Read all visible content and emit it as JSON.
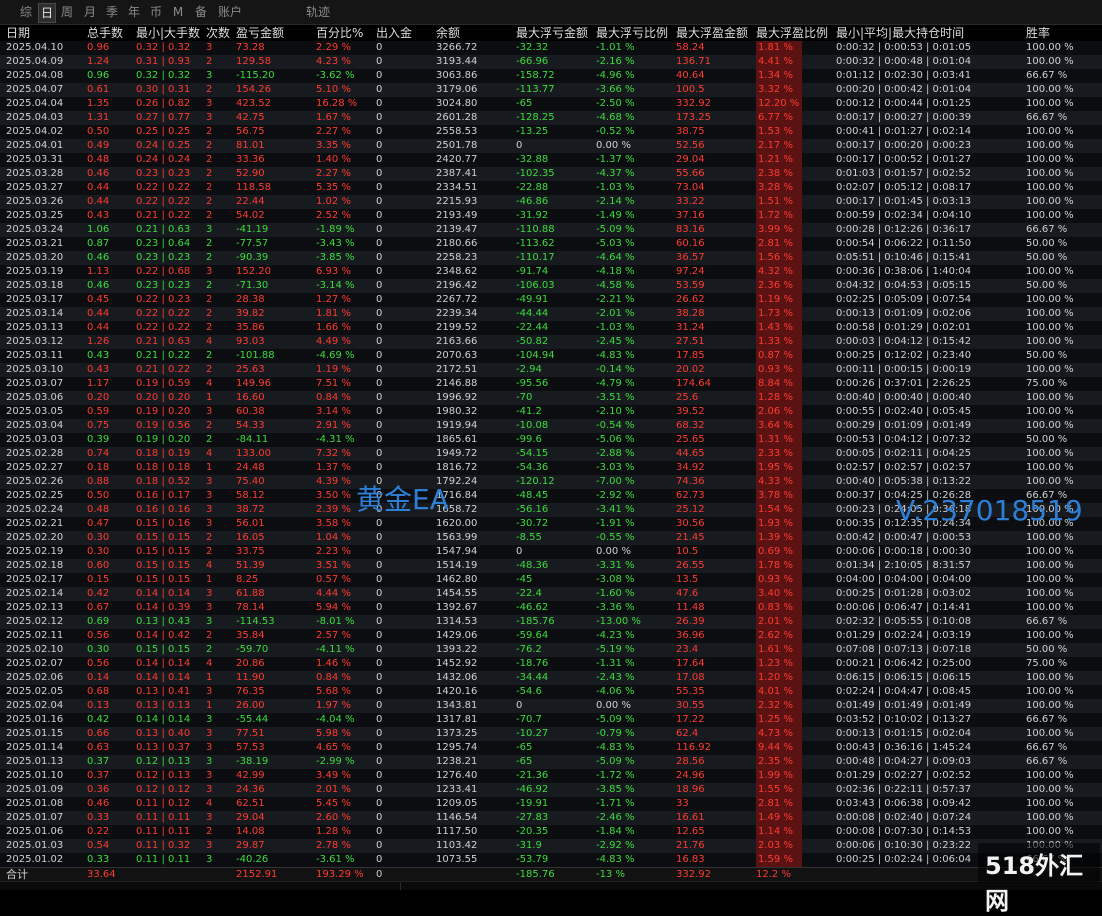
{
  "tabs": [
    {
      "label": "综",
      "active": false
    },
    {
      "label": "日",
      "active": true
    },
    {
      "label": "周",
      "active": false
    },
    {
      "label": "月",
      "active": false
    },
    {
      "label": "季",
      "active": false
    },
    {
      "label": "年",
      "active": false
    },
    {
      "label": "币",
      "active": false
    },
    {
      "label": "M",
      "active": false
    },
    {
      "label": "备",
      "active": false
    },
    {
      "label": "账户",
      "active": false
    },
    {
      "label": "轨迹",
      "active": false
    }
  ],
  "columns": [
    "日期",
    "总手数",
    "最小|大手数",
    "次数",
    "盈亏金额",
    "百分比%",
    "出入金",
    "余额",
    "最大浮亏金额",
    "最大浮亏比例",
    "最大浮盈金额",
    "最大浮盈比例",
    "最小|平均|最大持仓时间",
    "胜率"
  ],
  "rows": [
    [
      "2025.04.10",
      "0.96",
      "0.32 | 0.32",
      "3",
      "73.28",
      "2.29 %",
      "0",
      "3266.72",
      "-32.32",
      "-1.01 %",
      "58.24",
      "1.81 %",
      "0:00:32 | 0:00:53 | 0:01:05",
      "100.00 %"
    ],
    [
      "2025.04.09",
      "1.24",
      "0.31 | 0.93",
      "2",
      "129.58",
      "4.23 %",
      "0",
      "3193.44",
      "-66.96",
      "-2.16 %",
      "136.71",
      "4.41 %",
      "0:00:32 | 0:00:48 | 0:01:04",
      "100.00 %"
    ],
    [
      "2025.04.08",
      "0.96",
      "0.32 | 0.32",
      "3",
      "-115.20",
      "-3.62 %",
      "0",
      "3063.86",
      "-158.72",
      "-4.96 %",
      "40.64",
      "1.34 %",
      "0:01:12 | 0:02:30 | 0:03:41",
      "66.67 %"
    ],
    [
      "2025.04.07",
      "0.61",
      "0.30 | 0.31",
      "2",
      "154.26",
      "5.10 %",
      "0",
      "3179.06",
      "-113.77",
      "-3.66 %",
      "100.5",
      "3.32 %",
      "0:00:20 | 0:00:42 | 0:01:04",
      "100.00 %"
    ],
    [
      "2025.04.04",
      "1.35",
      "0.26 | 0.82",
      "3",
      "423.52",
      "16.28 %",
      "0",
      "3024.80",
      "-65",
      "-2.50 %",
      "332.92",
      "12.20 %",
      "0:00:12 | 0:00:44 | 0:01:25",
      "100.00 %"
    ],
    [
      "2025.04.03",
      "1.31",
      "0.27 | 0.77",
      "3",
      "42.75",
      "1.67 %",
      "0",
      "2601.28",
      "-128.25",
      "-4.68 %",
      "173.25",
      "6.77 %",
      "0:00:17 | 0:00:27 | 0:00:39",
      "66.67 %"
    ],
    [
      "2025.04.02",
      "0.50",
      "0.25 | 0.25",
      "2",
      "56.75",
      "2.27 %",
      "0",
      "2558.53",
      "-13.25",
      "-0.52 %",
      "38.75",
      "1.53 %",
      "0:00:41 | 0:01:27 | 0:02:14",
      "100.00 %"
    ],
    [
      "2025.04.01",
      "0.49",
      "0.24 | 0.25",
      "2",
      "81.01",
      "3.35 %",
      "0",
      "2501.78",
      "0",
      "0.00 %",
      "52.56",
      "2.17 %",
      "0:00:17 | 0:00:20 | 0:00:23",
      "100.00 %"
    ],
    [
      "2025.03.31",
      "0.48",
      "0.24 | 0.24",
      "2",
      "33.36",
      "1.40 %",
      "0",
      "2420.77",
      "-32.88",
      "-1.37 %",
      "29.04",
      "1.21 %",
      "0:00:17 | 0:00:52 | 0:01:27",
      "100.00 %"
    ],
    [
      "2025.03.28",
      "0.46",
      "0.23 | 0.23",
      "2",
      "52.90",
      "2.27 %",
      "0",
      "2387.41",
      "-102.35",
      "-4.37 %",
      "55.66",
      "2.38 %",
      "0:01:03 | 0:01:57 | 0:02:52",
      "100.00 %"
    ],
    [
      "2025.03.27",
      "0.44",
      "0.22 | 0.22",
      "2",
      "118.58",
      "5.35 %",
      "0",
      "2334.51",
      "-22.88",
      "-1.03 %",
      "73.04",
      "3.28 %",
      "0:02:07 | 0:05:12 | 0:08:17",
      "100.00 %"
    ],
    [
      "2025.03.26",
      "0.44",
      "0.22 | 0.22",
      "2",
      "22.44",
      "1.02 %",
      "0",
      "2215.93",
      "-46.86",
      "-2.14 %",
      "33.22",
      "1.51 %",
      "0:00:17 | 0:01:45 | 0:03:13",
      "100.00 %"
    ],
    [
      "2025.03.25",
      "0.43",
      "0.21 | 0.22",
      "2",
      "54.02",
      "2.52 %",
      "0",
      "2193.49",
      "-31.92",
      "-1.49 %",
      "37.16",
      "1.72 %",
      "0:00:59 | 0:02:34 | 0:04:10",
      "100.00 %"
    ],
    [
      "2025.03.24",
      "1.06",
      "0.21 | 0.63",
      "3",
      "-41.19",
      "-1.89 %",
      "0",
      "2139.47",
      "-110.88",
      "-5.09 %",
      "83.16",
      "3.99 %",
      "0:00:28 | 0:12:26 | 0:36:17",
      "66.67 %"
    ],
    [
      "2025.03.21",
      "0.87",
      "0.23 | 0.64",
      "2",
      "-77.57",
      "-3.43 %",
      "0",
      "2180.66",
      "-113.62",
      "-5.03 %",
      "60.16",
      "2.81 %",
      "0:00:54 | 0:06:22 | 0:11:50",
      "50.00 %"
    ],
    [
      "2025.03.20",
      "0.46",
      "0.23 | 0.23",
      "2",
      "-90.39",
      "-3.85 %",
      "0",
      "2258.23",
      "-110.17",
      "-4.64 %",
      "36.57",
      "1.56 %",
      "0:05:51 | 0:10:46 | 0:15:41",
      "50.00 %"
    ],
    [
      "2025.03.19",
      "1.13",
      "0.22 | 0.68",
      "3",
      "152.20",
      "6.93 %",
      "0",
      "2348.62",
      "-91.74",
      "-4.18 %",
      "97.24",
      "4.32 %",
      "0:00:36 | 0:38:06 | 1:40:04",
      "100.00 %"
    ],
    [
      "2025.03.18",
      "0.46",
      "0.23 | 0.23",
      "2",
      "-71.30",
      "-3.14 %",
      "0",
      "2196.42",
      "-106.03",
      "-4.58 %",
      "53.59",
      "2.36 %",
      "0:04:32 | 0:04:53 | 0:05:15",
      "50.00 %"
    ],
    [
      "2025.03.17",
      "0.45",
      "0.22 | 0.23",
      "2",
      "28.38",
      "1.27 %",
      "0",
      "2267.72",
      "-49.91",
      "-2.21 %",
      "26.62",
      "1.19 %",
      "0:02:25 | 0:05:09 | 0:07:54",
      "100.00 %"
    ],
    [
      "2025.03.14",
      "0.44",
      "0.22 | 0.22",
      "2",
      "39.82",
      "1.81 %",
      "0",
      "2239.34",
      "-44.44",
      "-2.01 %",
      "38.28",
      "1.73 %",
      "0:00:13 | 0:01:09 | 0:02:06",
      "100.00 %"
    ],
    [
      "2025.03.13",
      "0.44",
      "0.22 | 0.22",
      "2",
      "35.86",
      "1.66 %",
      "0",
      "2199.52",
      "-22.44",
      "-1.03 %",
      "31.24",
      "1.43 %",
      "0:00:58 | 0:01:29 | 0:02:01",
      "100.00 %"
    ],
    [
      "2025.03.12",
      "1.26",
      "0.21 | 0.63",
      "4",
      "93.03",
      "4.49 %",
      "0",
      "2163.66",
      "-50.82",
      "-2.45 %",
      "27.51",
      "1.33 %",
      "0:00:03 | 0:04:12 | 0:15:42",
      "100.00 %"
    ],
    [
      "2025.03.11",
      "0.43",
      "0.21 | 0.22",
      "2",
      "-101.88",
      "-4.69 %",
      "0",
      "2070.63",
      "-104.94",
      "-4.83 %",
      "17.85",
      "0.87 %",
      "0:00:25 | 0:12:02 | 0:23:40",
      "50.00 %"
    ],
    [
      "2025.03.10",
      "0.43",
      "0.21 | 0.22",
      "2",
      "25.63",
      "1.19 %",
      "0",
      "2172.51",
      "-2.94",
      "-0.14 %",
      "20.02",
      "0.93 %",
      "0:00:11 | 0:00:15 | 0:00:19",
      "100.00 %"
    ],
    [
      "2025.03.07",
      "1.17",
      "0.19 | 0.59",
      "4",
      "149.96",
      "7.51 %",
      "0",
      "2146.88",
      "-95.56",
      "-4.79 %",
      "174.64",
      "8.84 %",
      "0:00:26 | 0:37:01 | 2:26:25",
      "75.00 %"
    ],
    [
      "2025.03.06",
      "0.20",
      "0.20 | 0.20",
      "1",
      "16.60",
      "0.84 %",
      "0",
      "1996.92",
      "-70",
      "-3.51 %",
      "25.6",
      "1.28 %",
      "0:00:40 | 0:00:40 | 0:00:40",
      "100.00 %"
    ],
    [
      "2025.03.05",
      "0.59",
      "0.19 | 0.20",
      "3",
      "60.38",
      "3.14 %",
      "0",
      "1980.32",
      "-41.2",
      "-2.10 %",
      "39.52",
      "2.06 %",
      "0:00:55 | 0:02:40 | 0:05:45",
      "100.00 %"
    ],
    [
      "2025.03.04",
      "0.75",
      "0.19 | 0.56",
      "2",
      "54.33",
      "2.91 %",
      "0",
      "1919.94",
      "-10.08",
      "-0.54 %",
      "68.32",
      "3.64 %",
      "0:00:29 | 0:01:09 | 0:01:49",
      "100.00 %"
    ],
    [
      "2025.03.03",
      "0.39",
      "0.19 | 0.20",
      "2",
      "-84.11",
      "-4.31 %",
      "0",
      "1865.61",
      "-99.6",
      "-5.06 %",
      "25.65",
      "1.31 %",
      "0:00:53 | 0:04:12 | 0:07:32",
      "50.00 %"
    ],
    [
      "2025.02.28",
      "0.74",
      "0.18 | 0.19",
      "4",
      "133.00",
      "7.32 %",
      "0",
      "1949.72",
      "-54.15",
      "-2.88 %",
      "44.65",
      "2.33 %",
      "0:00:05 | 0:02:11 | 0:04:25",
      "100.00 %"
    ],
    [
      "2025.02.27",
      "0.18",
      "0.18 | 0.18",
      "1",
      "24.48",
      "1.37 %",
      "0",
      "1816.72",
      "-54.36",
      "-3.03 %",
      "34.92",
      "1.95 %",
      "0:02:57 | 0:02:57 | 0:02:57",
      "100.00 %"
    ],
    [
      "2025.02.26",
      "0.88",
      "0.18 | 0.52",
      "3",
      "75.40",
      "4.39 %",
      "0",
      "1792.24",
      "-120.12",
      "-7.00 %",
      "74.36",
      "4.33 %",
      "0:00:40 | 0:05:38 | 0:13:22",
      "100.00 %"
    ],
    [
      "2025.02.25",
      "0.50",
      "0.16 | 0.17",
      "3",
      "58.12",
      "3.50 %",
      "0",
      "1716.84",
      "-48.45",
      "-2.92 %",
      "62.73",
      "3.78 %",
      "0:00:37 | 0:04:25 | 0:26:28",
      "66.67 %"
    ],
    [
      "2025.02.24",
      "0.48",
      "0.16 | 0.16",
      "3",
      "38.72",
      "2.39 %",
      "0",
      "1658.72",
      "-56.16",
      "-3.41 %",
      "25.12",
      "1.54 %",
      "0:00:23 | 0:24:05 | 0:36:18",
      "100.00 %"
    ],
    [
      "2025.02.21",
      "0.47",
      "0.15 | 0.16",
      "3",
      "56.01",
      "3.58 %",
      "0",
      "1620.00",
      "-30.72",
      "-1.91 %",
      "30.56",
      "1.93 %",
      "0:00:35 | 0:12:35 | 0:24:34",
      "100.00 %"
    ],
    [
      "2025.02.20",
      "0.30",
      "0.15 | 0.15",
      "2",
      "16.05",
      "1.04 %",
      "0",
      "1563.99",
      "-8.55",
      "-0.55 %",
      "21.45",
      "1.39 %",
      "0:00:42 | 0:00:47 | 0:00:53",
      "100.00 %"
    ],
    [
      "2025.02.19",
      "0.30",
      "0.15 | 0.15",
      "2",
      "33.75",
      "2.23 %",
      "0",
      "1547.94",
      "0",
      "0.00 %",
      "10.5",
      "0.69 %",
      "0:00:06 | 0:00:18 | 0:00:30",
      "100.00 %"
    ],
    [
      "2025.02.18",
      "0.60",
      "0.15 | 0.15",
      "4",
      "51.39",
      "3.51 %",
      "0",
      "1514.19",
      "-48.36",
      "-3.31 %",
      "26.55",
      "1.78 %",
      "0:01:34 | 2:10:05 | 8:31:57",
      "100.00 %"
    ],
    [
      "2025.02.17",
      "0.15",
      "0.15 | 0.15",
      "1",
      "8.25",
      "0.57 %",
      "0",
      "1462.80",
      "-45",
      "-3.08 %",
      "13.5",
      "0.93 %",
      "0:04:00 | 0:04:00 | 0:04:00",
      "100.00 %"
    ],
    [
      "2025.02.14",
      "0.42",
      "0.14 | 0.14",
      "3",
      "61.88",
      "4.44 %",
      "0",
      "1454.55",
      "-22.4",
      "-1.60 %",
      "47.6",
      "3.40 %",
      "0:00:25 | 0:01:28 | 0:03:02",
      "100.00 %"
    ],
    [
      "2025.02.13",
      "0.67",
      "0.14 | 0.39",
      "3",
      "78.14",
      "5.94 %",
      "0",
      "1392.67",
      "-46.62",
      "-3.36 %",
      "11.48",
      "0.83 %",
      "0:00:06 | 0:06:47 | 0:14:41",
      "100.00 %"
    ],
    [
      "2025.02.12",
      "0.69",
      "0.13 | 0.43",
      "3",
      "-114.53",
      "-8.01 %",
      "0",
      "1314.53",
      "-185.76",
      "-13.00 %",
      "26.39",
      "2.01 %",
      "0:02:32 | 0:05:55 | 0:10:08",
      "66.67 %"
    ],
    [
      "2025.02.11",
      "0.56",
      "0.14 | 0.42",
      "2",
      "35.84",
      "2.57 %",
      "0",
      "1429.06",
      "-59.64",
      "-4.23 %",
      "36.96",
      "2.62 %",
      "0:01:29 | 0:02:24 | 0:03:19",
      "100.00 %"
    ],
    [
      "2025.02.10",
      "0.30",
      "0.15 | 0.15",
      "2",
      "-59.70",
      "-4.11 %",
      "0",
      "1393.22",
      "-76.2",
      "-5.19 %",
      "23.4",
      "1.61 %",
      "0:07:08 | 0:07:13 | 0:07:18",
      "50.00 %"
    ],
    [
      "2025.02.07",
      "0.56",
      "0.14 | 0.14",
      "4",
      "20.86",
      "1.46 %",
      "0",
      "1452.92",
      "-18.76",
      "-1.31 %",
      "17.64",
      "1.23 %",
      "0:00:21 | 0:06:42 | 0:25:00",
      "75.00 %"
    ],
    [
      "2025.02.06",
      "0.14",
      "0.14 | 0.14",
      "1",
      "11.90",
      "0.84 %",
      "0",
      "1432.06",
      "-34.44",
      "-2.43 %",
      "17.08",
      "1.20 %",
      "0:06:15 | 0:06:15 | 0:06:15",
      "100.00 %"
    ],
    [
      "2025.02.05",
      "0.68",
      "0.13 | 0.41",
      "3",
      "76.35",
      "5.68 %",
      "0",
      "1420.16",
      "-54.6",
      "-4.06 %",
      "55.35",
      "4.01 %",
      "0:02:24 | 0:04:47 | 0:08:45",
      "100.00 %"
    ],
    [
      "2025.02.04",
      "0.13",
      "0.13 | 0.13",
      "1",
      "26.00",
      "1.97 %",
      "0",
      "1343.81",
      "0",
      "0.00 %",
      "30.55",
      "2.32 %",
      "0:01:49 | 0:01:49 | 0:01:49",
      "100.00 %"
    ],
    [
      "2025.01.16",
      "0.42",
      "0.14 | 0.14",
      "3",
      "-55.44",
      "-4.04 %",
      "0",
      "1317.81",
      "-70.7",
      "-5.09 %",
      "17.22",
      "1.25 %",
      "0:03:52 | 0:10:02 | 0:13:27",
      "66.67 %"
    ],
    [
      "2025.01.15",
      "0.66",
      "0.13 | 0.40",
      "3",
      "77.51",
      "5.98 %",
      "0",
      "1373.25",
      "-10.27",
      "-0.79 %",
      "62.4",
      "4.73 %",
      "0:00:13 | 0:01:15 | 0:02:04",
      "100.00 %"
    ],
    [
      "2025.01.14",
      "0.63",
      "0.13 | 0.37",
      "3",
      "57.53",
      "4.65 %",
      "0",
      "1295.74",
      "-65",
      "-4.83 %",
      "116.92",
      "9.44 %",
      "0:00:43 | 0:36:16 | 1:45:24",
      "66.67 %"
    ],
    [
      "2025.01.13",
      "0.37",
      "0.12 | 0.13",
      "3",
      "-38.19",
      "-2.99 %",
      "0",
      "1238.21",
      "-65",
      "-5.09 %",
      "28.56",
      "2.35 %",
      "0:00:48 | 0:04:27 | 0:09:03",
      "66.67 %"
    ],
    [
      "2025.01.10",
      "0.37",
      "0.12 | 0.13",
      "3",
      "42.99",
      "3.49 %",
      "0",
      "1276.40",
      "-21.36",
      "-1.72 %",
      "24.96",
      "1.99 %",
      "0:01:29 | 0:02:27 | 0:02:52",
      "100.00 %"
    ],
    [
      "2025.01.09",
      "0.36",
      "0.12 | 0.12",
      "3",
      "24.36",
      "2.01 %",
      "0",
      "1233.41",
      "-46.92",
      "-3.85 %",
      "18.96",
      "1.55 %",
      "0:02:36 | 0:22:11 | 0:57:37",
      "100.00 %"
    ],
    [
      "2025.01.08",
      "0.46",
      "0.11 | 0.12",
      "4",
      "62.51",
      "5.45 %",
      "0",
      "1209.05",
      "-19.91",
      "-1.71 %",
      "33",
      "2.81 %",
      "0:03:43 | 0:06:38 | 0:09:42",
      "100.00 %"
    ],
    [
      "2025.01.07",
      "0.33",
      "0.11 | 0.11",
      "3",
      "29.04",
      "2.60 %",
      "0",
      "1146.54",
      "-27.83",
      "-2.46 %",
      "16.61",
      "1.49 %",
      "0:00:08 | 0:02:40 | 0:07:24",
      "100.00 %"
    ],
    [
      "2025.01.06",
      "0.22",
      "0.11 | 0.11",
      "2",
      "14.08",
      "1.28 %",
      "0",
      "1117.50",
      "-20.35",
      "-1.84 %",
      "12.65",
      "1.14 %",
      "0:00:08 | 0:07:30 | 0:14:53",
      "100.00 %"
    ],
    [
      "2025.01.03",
      "0.54",
      "0.11 | 0.32",
      "3",
      "29.87",
      "2.78 %",
      "0",
      "1103.42",
      "-31.9",
      "-2.92 %",
      "21.76",
      "2.03 %",
      "0:00:06 | 0:10:30 | 0:23:22",
      "100.00 %"
    ],
    [
      "2025.01.02",
      "0.33",
      "0.11 | 0.11",
      "3",
      "-40.26",
      "-3.61 %",
      "0",
      "1073.55",
      "-53.79",
      "-4.83 %",
      "16.83",
      "1.59 %",
      "0:00:25 | 0:02:24 | 0:06:04",
      "66.67 %"
    ]
  ],
  "totals": {
    "label": "合计",
    "lots": "33.64",
    "pnl": "2152.91",
    "pct": "193.29 %",
    "flow": "0",
    "max_float_loss": "-185.76",
    "max_float_loss_pct": "-13 %",
    "max_float_profit": "332.92",
    "max_float_profit_pct": "12.2 %"
  },
  "watermarks": {
    "left": "黄金EA",
    "right": "V:237018519",
    "logo": "518外汇网"
  },
  "colors": {
    "profit": "#ff3b30",
    "loss": "#3cdc3c",
    "profit_bg": "#5a1212",
    "loss_bg": "#0f4a12",
    "watermark": "#2d7fd6"
  }
}
